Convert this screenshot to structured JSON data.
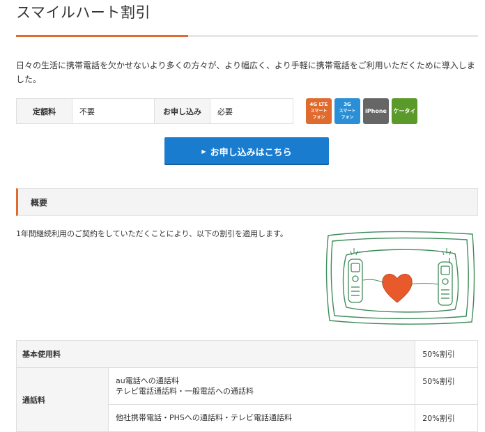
{
  "page": {
    "title": "スマイルハート割引",
    "intro": "日々の生活に携帯電話を欠かせないより多くの方々が、より幅広く、より手軽に携帯電話をご利用いただくために導入しました。"
  },
  "fees": {
    "fixed_label": "定額料",
    "fixed_value": "不要",
    "application_label": "お申し込み",
    "application_value": "必要"
  },
  "badges": [
    {
      "line1": "4G LTE",
      "line2": "スマート",
      "line3": "フォン",
      "color": "#e06b2e",
      "icon": "4g-lte-smartphone-badge"
    },
    {
      "line1": "3G",
      "line2": "スマート",
      "line3": "フォン",
      "color": "#2a8fd6",
      "icon": "3g-smartphone-badge"
    },
    {
      "line1": "iPhone",
      "color": "#666666",
      "icon": "iphone-badge"
    },
    {
      "line1": "ケータイ",
      "color": "#5a9a2a",
      "icon": "feature-phone-badge"
    }
  ],
  "apply_button": {
    "label": "お申し込みはこちら",
    "color": "#1a7ccf"
  },
  "overview": {
    "heading": "概要",
    "text": "1年間継続利用のご契約をしていただくことにより、以下の割引を適用します。"
  },
  "colors": {
    "accent": "#e06b2e",
    "illustration_frame": "#3e8c5a",
    "heart": "#e85a2c"
  },
  "discounts": {
    "basic_label": "基本使用料",
    "basic_rate": "50%割引",
    "call_label": "通話料",
    "call_item1_line1": "au電話への通話料",
    "call_item1_line2": "テレビ電話通話料・一般電話への通話料",
    "call_item1_rate": "50%割引",
    "call_item2": "他社携帯電話・PHSへの通話料・テレビ電話通話料",
    "call_item2_rate": "20%割引"
  }
}
